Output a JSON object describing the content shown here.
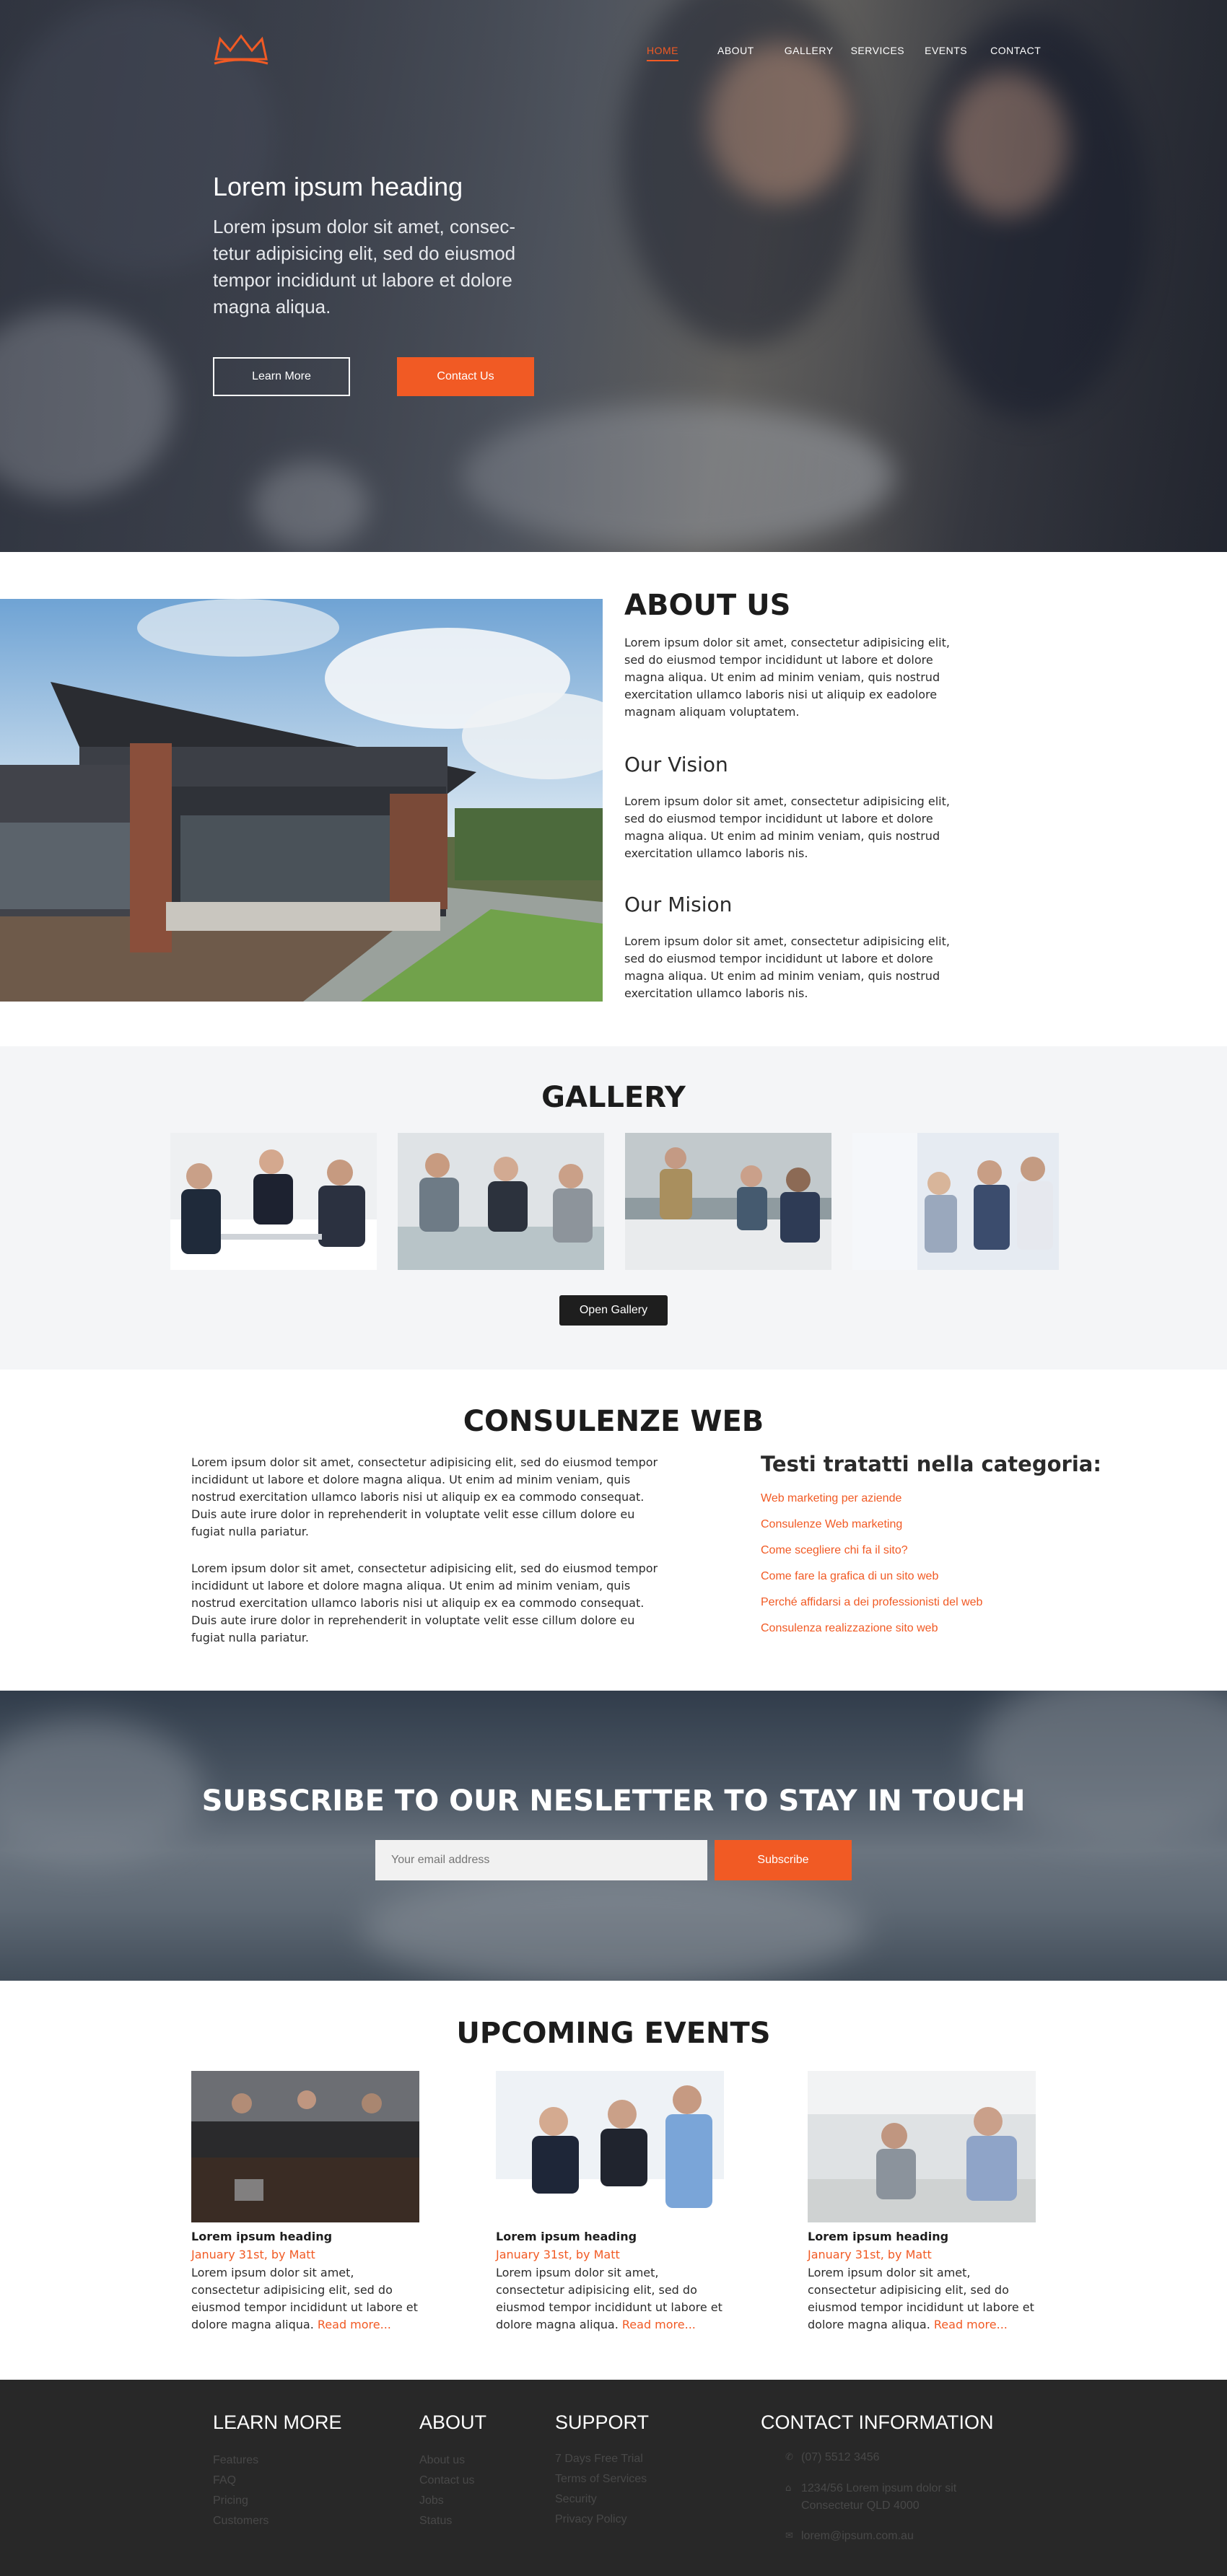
{
  "nav": {
    "items": [
      "HOME",
      "ABOUT",
      "GALLERY",
      "SERVICES",
      "EVENTS",
      "CONTACT"
    ],
    "active": "HOME"
  },
  "hero": {
    "heading": "Lorem ipsum heading",
    "text": "Lorem ipsum dolor sit amet, consec-tetur adipisicing elit, sed do eiusmod tempor incididunt ut labore et dolore magna aliqua.",
    "learn_more": "Learn More",
    "contact_us": "Contact Us"
  },
  "about": {
    "title": "ABOUT US",
    "text": "Lorem ipsum dolor sit amet, consectetur adipisicing elit, sed do eiusmod tempor incididunt ut labore et dolore magna aliqua. Ut enim ad minim veniam, quis nostrud exercitation ullamco laboris nisi ut aliquip ex eadolore magnam aliquam voluptatem.",
    "vision_title": "Our Vision",
    "vision_text": "Lorem ipsum dolor sit amet, consectetur adipisicing elit, sed do eiusmod tempor incididunt ut labore et dolore magna aliqua. Ut enim ad minim veniam, quis nostrud exercitation ullamco laboris nis.",
    "mission_title": "Our Mision",
    "mission_text": "Lorem ipsum dolor sit amet, consectetur adipisicing elit, sed do eiusmod tempor incididunt ut labore et dolore magna aliqua. Ut enim ad minim veniam, quis nostrud exercitation ullamco laboris nis."
  },
  "gallery": {
    "title": "GALLERY",
    "button": "Open Gallery"
  },
  "consulenze": {
    "title": "CONSULENZE WEB",
    "paragraph1": "Lorem ipsum dolor sit amet, consectetur adipisicing elit, sed do eiusmod tempor incididunt ut labore et dolore magna aliqua. Ut enim ad minim veniam, quis nostrud exercitation ullamco laboris nisi ut aliquip ex ea commodo consequat. Duis aute irure dolor in reprehenderit in voluptate velit esse cillum dolore eu fugiat nulla pariatur.",
    "paragraph2": "Lorem ipsum dolor sit amet, consectetur adipisicing elit, sed do eiusmod tempor incididunt ut labore et dolore magna aliqua. Ut enim ad minim veniam, quis nostrud exercitation ullamco laboris nisi ut aliquip ex ea commodo consequat. Duis aute irure dolor in reprehenderit in voluptate velit esse cillum dolore eu fugiat nulla pariatur.",
    "category_title": "Testi tratatti nella categoria:",
    "categories": [
      "Web marketing per aziende",
      "Consulenze Web marketing",
      "Come scegliere chi fa il sito?",
      "Come fare la grafica di un sito web",
      "Perché affidarsi a dei professionisti del web",
      "Consulenza realizzazione sito web"
    ]
  },
  "newsletter": {
    "title": "SUBSCRIBE TO OUR NESLETTER TO STAY IN TOUCH",
    "placeholder": "Your email address",
    "button": "Subscribe"
  },
  "events": {
    "title": "UPCOMING EVENTS",
    "items": [
      {
        "heading": "Lorem ipsum heading",
        "date": "January 31st, by Matt",
        "text": "Lorem ipsum dolor sit amet, consectetur adipisicing elit, sed do eiusmod tempor incididunt ut labore et dolore magna aliqua.",
        "read_more": "Read more..."
      },
      {
        "heading": "Lorem ipsum heading",
        "date": "January 31st, by Matt",
        "text": "Lorem ipsum dolor sit amet, consectetur adipisicing elit, sed do eiusmod tempor incididunt ut labore et dolore magna aliqua.",
        "read_more": "Read more..."
      },
      {
        "heading": "Lorem ipsum heading",
        "date": "January 31st, by Matt",
        "text": "Lorem ipsum dolor sit amet, consectetur adipisicing elit, sed do eiusmod tempor incididunt ut labore et dolore magna aliqua.",
        "read_more": "Read more..."
      }
    ]
  },
  "footer": {
    "learn_more": {
      "title": "LEARN MORE",
      "items": [
        "Features",
        "FAQ",
        "Pricing",
        "Customers"
      ]
    },
    "about": {
      "title": "ABOUT",
      "items": [
        "About us",
        "Contact us",
        "Jobs",
        "Status"
      ]
    },
    "support": {
      "title": "SUPPORT",
      "items": [
        "7 Days Free Trial",
        "Terms of Services",
        "Security",
        "Privacy Policy"
      ]
    },
    "contact": {
      "title": "CONTACT INFORMATION",
      "phone": "(07) 5512 3456",
      "address_line1": "1234/56 Lorem ipsum dolor sit",
      "address_line2": "Consectetur QLD 4000",
      "email": "lorem@ipsum.com.au"
    }
  },
  "colors": {
    "accent": "#f15a24",
    "footer_bg": "#282828",
    "gallery_bg": "#f4f5f7"
  },
  "icons": [
    "crown-logo-icon",
    "phone-icon",
    "home-icon",
    "mail-icon"
  ]
}
